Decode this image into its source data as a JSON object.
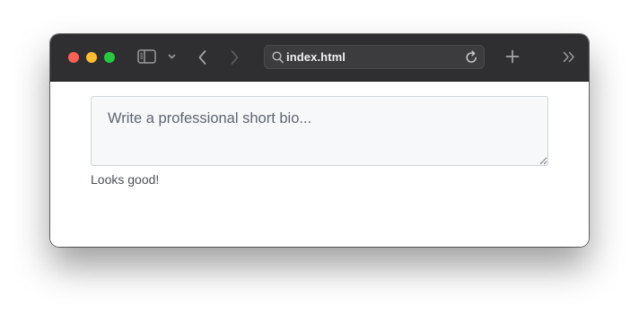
{
  "browser": {
    "url": "index.html",
    "icons": {
      "sidebar": "sidebar-icon",
      "chevron_down": "chevron-down-icon",
      "back": "chevron-left-icon",
      "forward": "chevron-right-icon",
      "search": "search-icon",
      "reload": "reload-icon",
      "new_tab": "plus-icon",
      "overflow": "double-chevron-right-icon"
    },
    "colors": {
      "toolbar": "#2f2f31",
      "close": "#fe5f57",
      "minimize": "#febc2e",
      "zoom": "#28c840"
    }
  },
  "form": {
    "bio_placeholder": "Write a professional short bio...",
    "bio_value": "",
    "feedback": "Looks good!"
  }
}
